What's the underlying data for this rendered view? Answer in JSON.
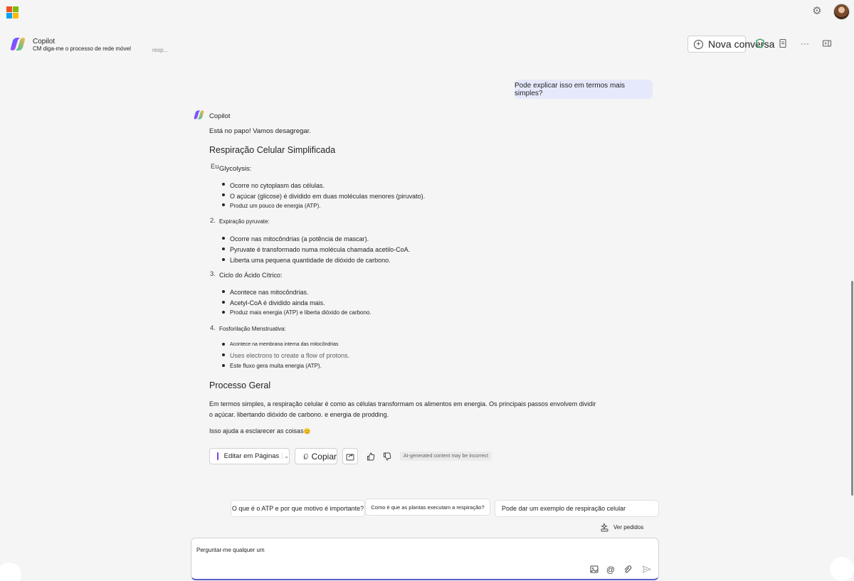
{
  "app": {
    "name": "Copilot"
  },
  "header": {
    "title": "Copilot",
    "subtitle": "CM diga-me o processo de rede móvel",
    "status": "resp...",
    "new_conversation": "Nova conversa"
  },
  "user_message": "Pode explicar isso em termos mais simples?",
  "response": {
    "author": "Copilot",
    "intro": "Está no papo! Vamos desagregar.",
    "heading": "Respiração Celular Simplificada",
    "steps": [
      {
        "marker": "Eu.",
        "title": "Glycolysis:",
        "bullets": [
          "Ocorre no cytoplasm das células.",
          "O açúcar (glicose) é dividido em duas moléculas menores (piruvato).",
          "Produz um pouco de energia (ATP)."
        ]
      },
      {
        "marker": "2.",
        "title": "Expiração pyruvate:",
        "bullets": [
          "Ocorre nas mitocôndrias (a potência de mascar).",
          "Pyruvate é transformado numa molécula chamada acetilo-CoA.",
          "Liberta uma pequena quantidade de dióxido de carbono."
        ]
      },
      {
        "marker": "3.",
        "title": "Ciclo do Ácido Cítrico:",
        "bullets": [
          "Acontece nas mitocôndrias.",
          "Acetyl-CoA é dividido ainda mais.",
          "Produz mais energia (ATP) e liberta dióxido de carbono."
        ]
      },
      {
        "marker": "4.",
        "title": "Fosforilação Menstruativa:",
        "bullets": [
          "Acontece na membrana interna das mitocôndrias",
          "Uses electrons to create a flow of protons.",
          "Este fluxo gera muita energia (ATP)."
        ]
      }
    ],
    "summary_heading": "Processo Geral",
    "summary_line1": "Em termos simples, a respiração celular é como as células transformam os alimentos em energia. Os principais passos envolvem dividir",
    "summary_line2": "o açúcar. libertando dióxido de carbono. e energia de prodding.",
    "closing": "Isso ajuda a esclarecer as coisas",
    "closing_emoji": "😊"
  },
  "actions": {
    "edit_in_pages": "Editar em Páginas",
    "copy": "Copiar",
    "disclaimer": "AI-generated content may be incorrect"
  },
  "suggestions": [
    "O que é o ATP e por que motivo é importante?",
    "Como é que as plantas executam a respiração?",
    "Pode dar um exemplo de respiração celular"
  ],
  "see_prompts": "Ver pedidos",
  "composer": {
    "placeholder": "Perguntar-me qualquer um"
  },
  "colors": {
    "accent": "#5b5fc7",
    "user_bubble": "#e6e9fb",
    "background": "#f5f5f5",
    "pages_icon": "#7b3fe4"
  },
  "icons": {
    "settings": "gear-icon",
    "new_conversation": "plus-circle-icon",
    "shield": "shield-icon",
    "notebook": "notebook-icon",
    "more": "more-icon",
    "side_panel": "side-panel-icon",
    "pages": "pages-icon",
    "copy": "copy-icon",
    "share": "share-icon",
    "thumbs_up": "thumbs-up-icon",
    "thumbs_down": "thumbs-down-icon",
    "prompts": "prompts-icon",
    "image": "image-icon",
    "mention": "at-icon",
    "attach": "paperclip-icon",
    "send": "send-icon"
  }
}
